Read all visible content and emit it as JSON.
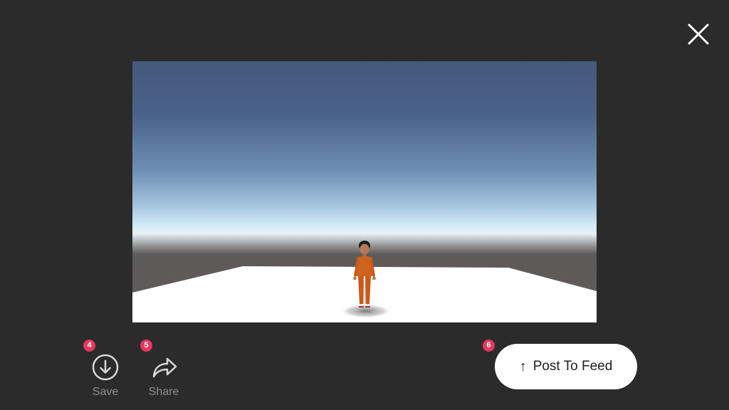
{
  "header": {
    "close_icon": "close-x-icon"
  },
  "preview": {
    "scene": "avatar-on-white-floor"
  },
  "actions": {
    "save": {
      "label": "Save",
      "badge": "4",
      "icon": "download-circle-icon"
    },
    "share": {
      "label": "Share",
      "badge": "5",
      "icon": "share-arrow-icon"
    },
    "post": {
      "label": "Post To Feed",
      "arrow": "↑",
      "badge": "6",
      "icon": "arrow-up-icon"
    }
  },
  "colors": {
    "background": "#2b2b2b",
    "badge": "#e8375f",
    "label_gray": "#8e8e8e",
    "button_bg": "#ffffff"
  }
}
